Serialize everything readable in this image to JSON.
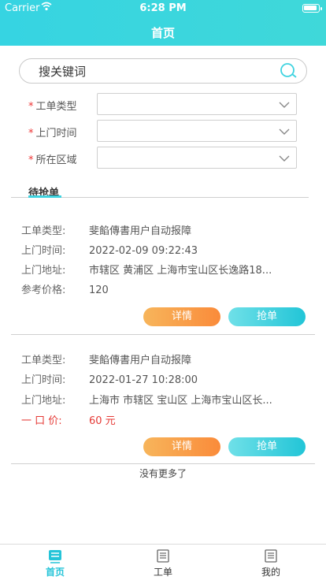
{
  "status_bar": {
    "carrier": "Carrier",
    "time": "6:28 PM"
  },
  "header": {
    "title": "首页"
  },
  "search": {
    "placeholder": "搜关键词",
    "value": ""
  },
  "form": {
    "required_mark": "*",
    "fields": [
      {
        "label": "工单类型",
        "value": ""
      },
      {
        "label": "上门时间",
        "value": ""
      },
      {
        "label": "所在区域",
        "value": ""
      }
    ]
  },
  "tab": {
    "label": "待抢单"
  },
  "orders": [
    {
      "type_label": "工单类型:",
      "type_value": "斐餡傳書用户自动报障",
      "time_label": "上门时间:",
      "time_value": "2022-02-09 09:22:43",
      "addr_label": "上门地址:",
      "addr_value": "市辖区 黄浦区 上海市宝山区长逸路18...",
      "price_label": "参考价格:",
      "price_value": "120",
      "detail_button": "详情",
      "grab_button": "抢单"
    },
    {
      "type_label": "工单类型:",
      "type_value": "斐餡傳書用户自动报障",
      "time_label": "上门时间:",
      "time_value": "2022-01-27 10:28:00",
      "addr_label": "上门地址:",
      "addr_value": "上海市 市辖区 宝山区 上海市宝山区长...",
      "price_label": "一 口 价:",
      "price_value": "60 元",
      "detail_button": "详情",
      "grab_button": "抢单"
    }
  ],
  "footer_text": "没有更多了",
  "bottom_nav": [
    {
      "label": "首页",
      "active": true
    },
    {
      "label": "工单",
      "active": false
    },
    {
      "label": "我的",
      "active": false
    }
  ],
  "colors": {
    "header": "#36d4e2",
    "accent": "#25c4d8",
    "detail_button": "#fa8b3a",
    "price_red": "#e53935"
  }
}
